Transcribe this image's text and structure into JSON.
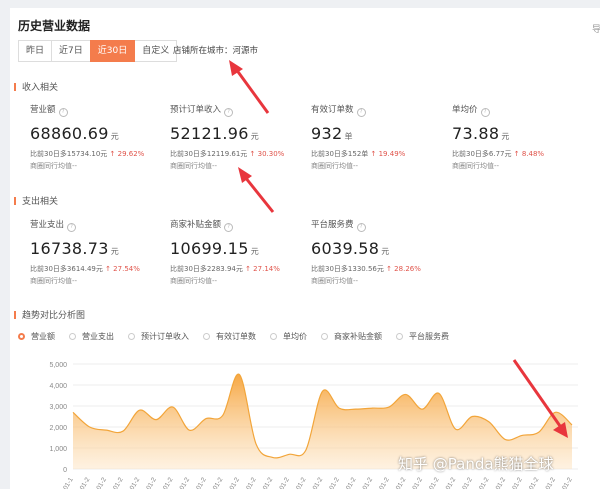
{
  "page": {
    "title": "历史营业数据",
    "more": "导",
    "tabs": [
      {
        "label": "昨日",
        "active": false
      },
      {
        "label": "近7日",
        "active": false
      },
      {
        "label": "近30日",
        "active": true
      },
      {
        "label": "自定义",
        "active": false
      }
    ],
    "city": "店铺所在城市：河源市"
  },
  "income": {
    "section": "收入相关",
    "metrics": [
      {
        "label": "营业额",
        "value": "68860.69",
        "unit": "元",
        "cmp": "比前30日多15734.10元",
        "pct": "↑ 29.62%",
        "peer": "商圈同行均值--"
      },
      {
        "label": "预计订单收入",
        "value": "52121.96",
        "unit": "元",
        "cmp": "比前30日多12119.61元",
        "pct": "↑ 30.30%",
        "peer": "商圈同行均值--"
      },
      {
        "label": "有效订单数",
        "value": "932",
        "unit": "单",
        "cmp": "比前30日多152单",
        "pct": "↑ 19.49%",
        "peer": "商圈同行均值--"
      },
      {
        "label": "单均价",
        "value": "73.88",
        "unit": "元",
        "cmp": "比前30日多6.77元",
        "pct": "↑ 8.48%",
        "peer": "商圈同行均值--"
      }
    ]
  },
  "expense": {
    "section": "支出相关",
    "metrics": [
      {
        "label": "营业支出",
        "value": "16738.73",
        "unit": "元",
        "cmp": "比前30日多3614.49元",
        "pct": "↑ 27.54%",
        "peer": "商圈同行均值--"
      },
      {
        "label": "商家补贴金额",
        "value": "10699.15",
        "unit": "元",
        "cmp": "比前30日多2283.94元",
        "pct": "↑ 27.14%",
        "peer": "商圈同行均值--"
      },
      {
        "label": "平台服务费",
        "value": "6039.58",
        "unit": "元",
        "cmp": "比前30日多1330.56元",
        "pct": "↑ 28.26%",
        "peer": "商圈同行均值--"
      }
    ]
  },
  "trend": {
    "section": "趋势对比分析图",
    "legend": [
      {
        "label": "营业额",
        "active": true
      },
      {
        "label": "营业支出",
        "active": false
      },
      {
        "label": "预计订单收入",
        "active": false
      },
      {
        "label": "有效订单数",
        "active": false
      },
      {
        "label": "单均价",
        "active": false
      },
      {
        "label": "商家补贴金额",
        "active": false
      },
      {
        "label": "平台服务费",
        "active": false
      }
    ]
  },
  "watermark": "知乎 @Panda熊猫全球",
  "colors": {
    "accent": "#f47c4c",
    "line": "#f2a53a",
    "up": "#e0534a",
    "arrow": "#e8363d"
  },
  "chart_data": {
    "type": "area",
    "series": [
      {
        "values": [
          2700,
          2000,
          1850,
          1800,
          2800,
          2350,
          2950,
          1850,
          2400,
          2550,
          4500,
          1200,
          550,
          700,
          900,
          3700,
          2900,
          2850,
          2900,
          2950,
          3550,
          2850,
          3600,
          1900,
          2500,
          2250,
          1400,
          1600,
          1750,
          2700,
          2100
        ]
      }
    ],
    "y_ticks": [
      "0",
      "1,000",
      "2,000",
      "3,000",
      "4,000",
      "5,000"
    ],
    "ylim": [
      0,
      5000
    ],
    "x_tick_labels": [
      "01-1",
      "01-2",
      "01-2",
      "01-2",
      "01-2",
      "01-2",
      "01-2",
      "01-2",
      "01-2",
      "01-2",
      "01-2",
      "01-2",
      "01-2",
      "01-2",
      "01-2",
      "01-2",
      "01-2",
      "01-2",
      "01-2",
      "01-2",
      "01-2",
      "01-2",
      "01-2",
      "01-2",
      "01-2",
      "01-2",
      "01-2",
      "01-2",
      "01-2",
      "01-2",
      "01-2"
    ],
    "grid": true
  }
}
